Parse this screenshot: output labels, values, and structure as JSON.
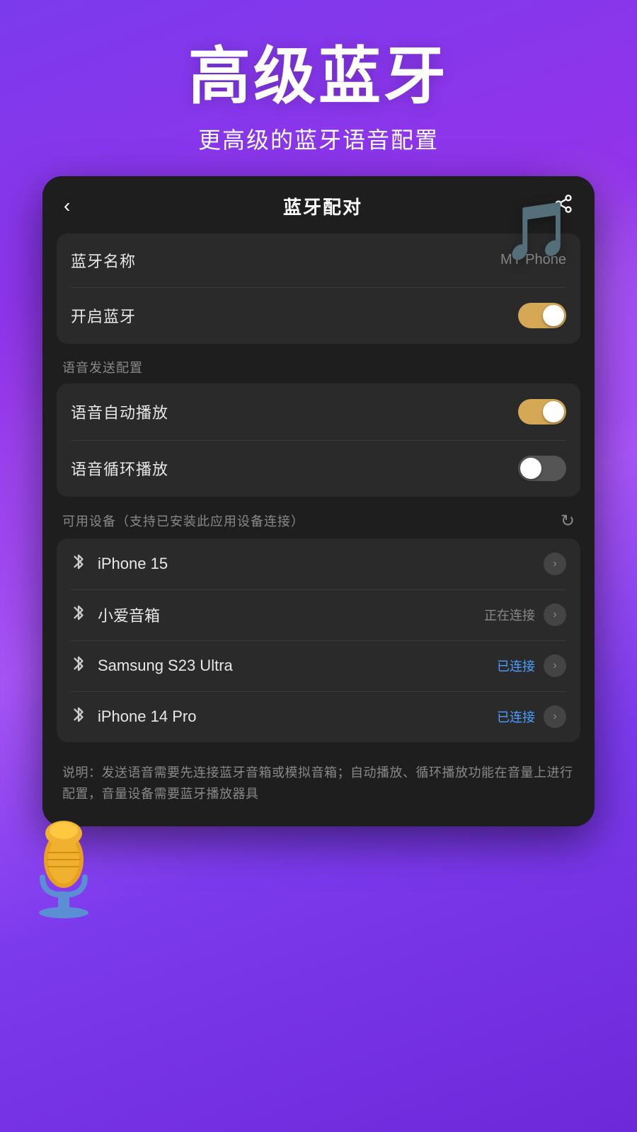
{
  "header": {
    "main_title": "高级蓝牙",
    "sub_title": "更高级的蓝牙语音配置"
  },
  "topbar": {
    "title": "蓝牙配对",
    "back_label": "‹",
    "share_label": "⎙"
  },
  "bluetooth_section": {
    "name_label": "蓝牙名称",
    "name_value": "MY Phone",
    "enable_label": "开启蓝牙",
    "enable_state": "on"
  },
  "voice_section": {
    "section_label": "语音发送配置",
    "auto_play_label": "语音自动播放",
    "auto_play_state": "on",
    "loop_play_label": "语音循环播放",
    "loop_play_state": "off"
  },
  "devices_section": {
    "section_label": "可用设备（支持已安装此应用设备连接）",
    "refresh_icon": "↻",
    "devices": [
      {
        "name": "iPhone 15",
        "status": "",
        "status_type": "none"
      },
      {
        "name": "小爱音箱",
        "status": "正在连接",
        "status_type": "connecting"
      },
      {
        "name": "Samsung  S23 Ultra",
        "status": "已连接",
        "status_type": "connected"
      },
      {
        "name": "iPhone 14 Pro",
        "status": "已连接",
        "status_type": "connected"
      }
    ]
  },
  "description": "说明：发送语音需要先连接蓝牙音箱或模拟音箱；自动播放、循环播放功能在音量上进行配置，音量设备需要蓝牙播放器具"
}
